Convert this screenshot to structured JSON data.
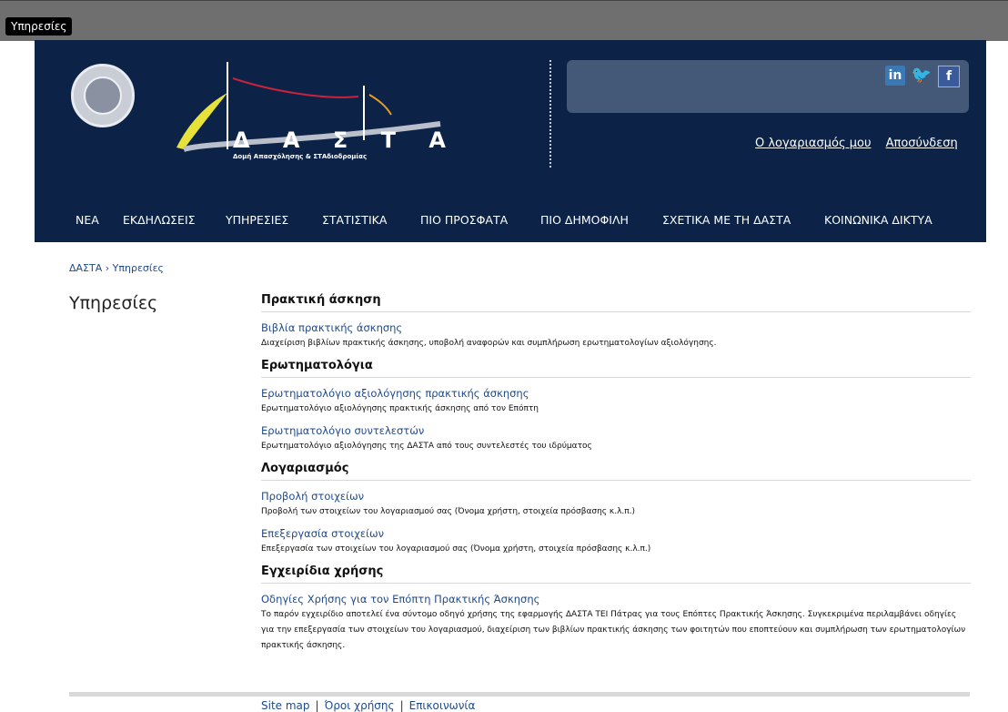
{
  "window": {
    "tab_label": "Υπηρεσίες"
  },
  "header": {
    "logo_title": "Δ Α Σ Τ Α",
    "logo_subtitle": "Δομή Απασχόλησης & ΣΤΑδιοδρομίας",
    "social": [
      {
        "name": "linkedin-icon",
        "glyph": "in"
      },
      {
        "name": "twitter-icon",
        "glyph": "🐦"
      },
      {
        "name": "facebook-icon",
        "glyph": "f"
      }
    ],
    "account_link": "Ο λογαριασμός μου",
    "logout_link": "Αποσύνδεση"
  },
  "nav": {
    "items": [
      "ΝΕΑ",
      "ΕΚΔΗΛΩΣΕΙΣ",
      "ΥΠΗΡΕΣΙΕΣ",
      "ΣΤΑΤΙΣΤΙΚΑ",
      "ΠΙΟ ΠΡΟΣΦΑΤΑ",
      "ΠΙΟ ΔΗΜΟΦΙΛΗ",
      "ΣΧΕΤΙΚΑ ΜΕ ΤΗ ΔΑΣΤΑ",
      "ΚΟΙΝΩΝΙΚΑ ΔΙΚΤΥΑ"
    ]
  },
  "breadcrumb": {
    "root": "ΔΑΣΤΑ",
    "separator": " › ",
    "current": "Υπηρεσίες"
  },
  "page_title": "Υπηρεσίες",
  "sections": [
    {
      "heading": "Πρακτική άσκηση",
      "entries": [
        {
          "link": "Βιβλία πρακτικής άσκησης",
          "desc": "Διαχείριση βιβλίων πρακτικής άσκησης, υποβολή αναφορών και συμπλήρωση ερωτηματολογίων αξιολόγησης."
        }
      ]
    },
    {
      "heading": "Ερωτηματολόγια",
      "entries": [
        {
          "link": "Ερωτηματολόγιο αξιολόγησης πρακτικής άσκησης",
          "desc": "Ερωτηματολόγιο αξιολόγησης πρακτικής άσκησης από τον Επόπτη"
        },
        {
          "link": "Ερωτηματολόγιο συντελεστών",
          "desc": "Ερωτηματολόγιο αξιολόγησης της ΔΑΣΤΑ από τους συντελεστές του ιδρύματος"
        }
      ]
    },
    {
      "heading": "Λογαριασμός",
      "entries": [
        {
          "link": "Προβολή στοιχείων",
          "desc": "Προβολή των στοιχείων του λογαριασμού σας (Όνομα χρήστη, στοιχεία πρόσβασης κ.λ.π.)"
        },
        {
          "link": "Επεξεργασία στοιχείων",
          "desc": "Επεξεργασία των στοιχείων του λογαριασμού σας (Όνομα χρήστη, στοιχεία πρόσβασης κ.λ.π.)"
        }
      ]
    },
    {
      "heading": "Εγχειρίδια χρήσης",
      "entries": [
        {
          "link": "Οδηγίες Χρήσης για τον Επόπτη Πρακτικής Άσκησης",
          "desc": "Το παρόν εγχειρίδιο αποτελεί ένα σύντομο οδηγό χρήσης της εφαρμογής ΔΑΣΤΑ ΤΕΙ Πάτρας για τους Επόπτες Πρακτικής Άσκησης. Συγκεκριμένα περιλαμβάνει οδηγίες για την επεξεργασία των στοιχείων του λογαριασμού, διαχείριση των βιβλίων πρακτικής άσκησης των φοιτητών που εποπτεύουν και συμπλήρωση των ερωτηματολογίων πρακτικής άσκησης."
        }
      ]
    }
  ],
  "footer": {
    "links": [
      "Site map",
      "Όροι χρήσης",
      "Επικοινωνία"
    ],
    "separator": "|"
  },
  "colors": {
    "header_bg": "#0c2347",
    "link": "#1f4a8a",
    "topbar": "#6f6f6f"
  }
}
